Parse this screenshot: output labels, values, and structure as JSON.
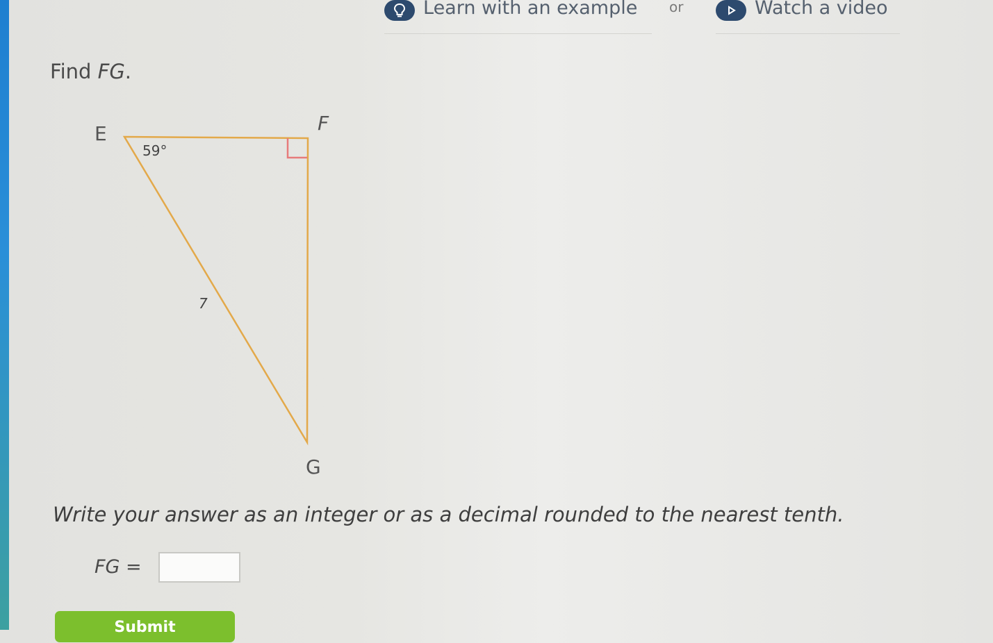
{
  "help": {
    "learn_label": "Learn with an example",
    "learn_icon": "lightbulb-icon",
    "or_label": "or",
    "video_label": "Watch a video",
    "video_icon": "play-icon",
    "icon_color": "#2d4a6e"
  },
  "problem": {
    "prompt_prefix": "Find ",
    "prompt_var": "FG",
    "prompt_suffix": "."
  },
  "diagram": {
    "vertices": {
      "E": "E",
      "F": "F",
      "G": "G"
    },
    "angle_label": "59°",
    "side_label": "7",
    "line_color": "#e3a94a",
    "right_angle_color": "#e77b7b"
  },
  "instruction": "Write your answer as an integer or as a decimal rounded to the nearest tenth.",
  "answer": {
    "var": "FG",
    "equals": " =",
    "value": ""
  },
  "submit": {
    "label": "Submit",
    "color": "#7cbf2d"
  }
}
